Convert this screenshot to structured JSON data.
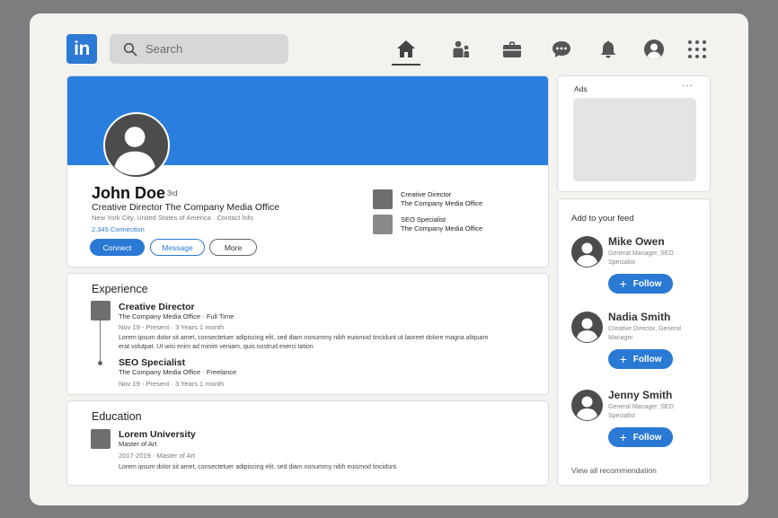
{
  "logo": {
    "text": "in"
  },
  "search": {
    "placeholder": "Search"
  },
  "nav": {
    "icons": [
      "home-icon",
      "people-icon",
      "briefcase-icon",
      "messaging-icon",
      "notifications-icon",
      "me-avatar-icon",
      "apps-grid-icon"
    ],
    "active": "home-icon"
  },
  "profile": {
    "name": "John Doe",
    "degree": "· 3rd",
    "headline": "Creative Director The Company Media Office",
    "location": "New York City, United States of America · Contact Info",
    "connections": "2.345 Connection",
    "buttons": {
      "connect": "Connect",
      "message": "Message",
      "more": "More"
    },
    "positions": [
      {
        "title": "Creative Director",
        "company": "The Company Media Office"
      },
      {
        "title": "SEO Specialist",
        "company": "The Company Media Office"
      }
    ]
  },
  "experience": {
    "heading": "Experience",
    "items": [
      {
        "title": "Creative Director",
        "company": "The Company Media Office · Full Time",
        "dates": "Nov 19 - Present · 3 Years 1 month",
        "description": "Lorem ipsum dolor sit amet, consectetuer adipiscing elit, sed diam nonummy nibh euismod tincidunt ut laoreet dolore magna aliquam erat volutpat. Ut wisi enim ad minim veniam, quis nostrud exerci tation"
      },
      {
        "title": "SEO Specialist",
        "company": "The Company Media Office · Freelance",
        "dates": "Nov 19 - Present · 3 Years 1 month"
      }
    ]
  },
  "education": {
    "heading": "Education",
    "items": [
      {
        "school": "Lorem University",
        "degree": "Master of Art",
        "dates": "2017-2019 · Master of Art",
        "description": "Lorem ipsum dolor sit amet, consectetuer adipiscing elit, sed diam nonummy nibh euismod tincidunt."
      }
    ]
  },
  "ads": {
    "label": "Ads",
    "menu": "···"
  },
  "feed": {
    "heading": "Add to your feed",
    "follow_label": "Follow",
    "people": [
      {
        "name": "Mike Owen",
        "subtitle": "General Manager, SEO Specialist"
      },
      {
        "name": "Nadia Smith",
        "subtitle": "Creative Director, General Manager"
      },
      {
        "name": "Jenny Smith",
        "subtitle": "General Manager, SEO Specialist"
      }
    ],
    "view_all": "View all recommendation"
  },
  "colors": {
    "accent": "#2a79d4",
    "banner": "#2a7ede",
    "frame": "#f3f2ef",
    "backdrop": "#7b7d7e"
  }
}
